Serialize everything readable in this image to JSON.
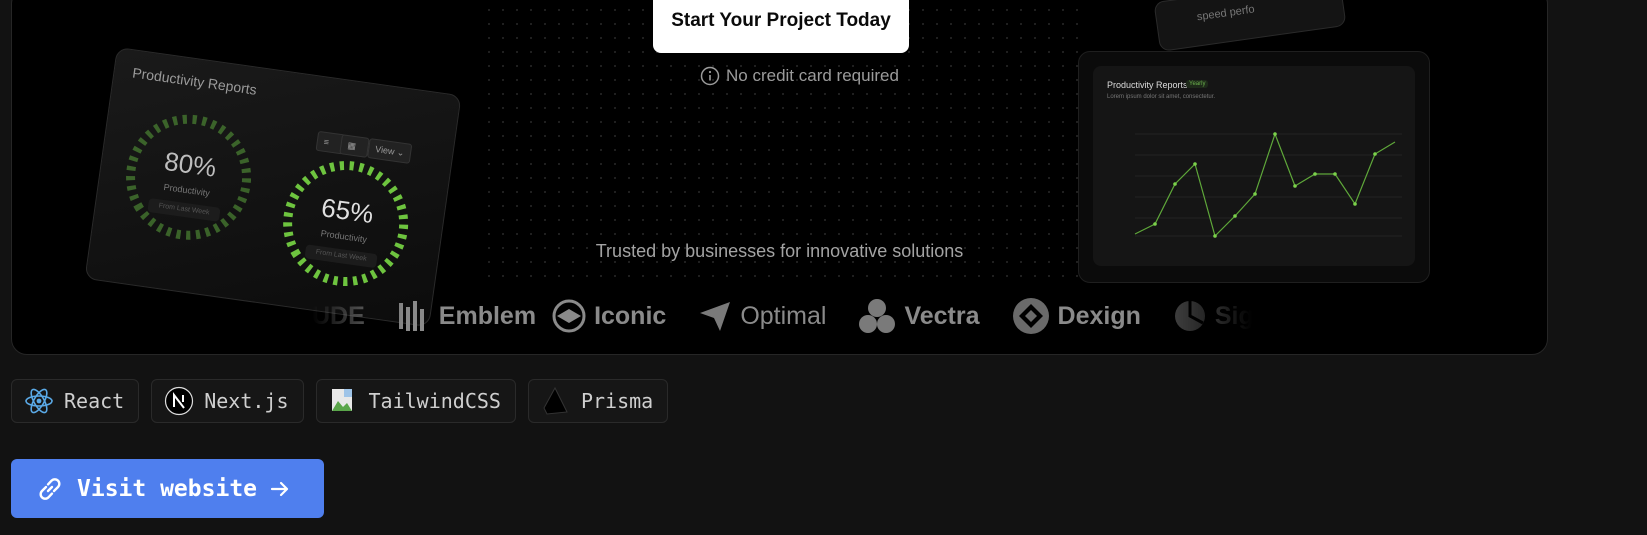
{
  "hero": {
    "cta_label": "Start Your Project Today",
    "no_card_text": "No credit card required",
    "trusted_text": "Trusted by businesses for innovative solutions"
  },
  "card_left": {
    "title": "Productivity Reports",
    "view_label": "View",
    "gauges": [
      {
        "percent": "80%",
        "label": "Productivity",
        "sub": "From Last Week"
      },
      {
        "percent": "65%",
        "label": "Productivity",
        "sub": "From Last Week"
      }
    ]
  },
  "card_topright": {
    "text": "speed perfo"
  },
  "card_right": {
    "title": "Productivity Reports",
    "badge": "Yearly",
    "subtitle": "Lorem ipsum dolor sit amet, consectetur."
  },
  "logos": [
    {
      "name": "UDE"
    },
    {
      "name": "Emblem"
    },
    {
      "name": "Iconic"
    },
    {
      "name": "Optimal"
    },
    {
      "name": "Vectra"
    },
    {
      "name": "Dexign"
    },
    {
      "name": "Sig"
    }
  ],
  "tags": [
    {
      "label": "React",
      "icon": "react-icon"
    },
    {
      "label": "Next.js",
      "icon": "nextjs-icon"
    },
    {
      "label": "TailwindCSS",
      "icon": "broken-image-icon"
    },
    {
      "label": "Prisma",
      "icon": "prisma-icon"
    }
  ],
  "visit": {
    "label": "Visit website"
  },
  "colors": {
    "accent": "#4f7fee",
    "chart_green": "#7bd24b",
    "background": "#121212"
  }
}
